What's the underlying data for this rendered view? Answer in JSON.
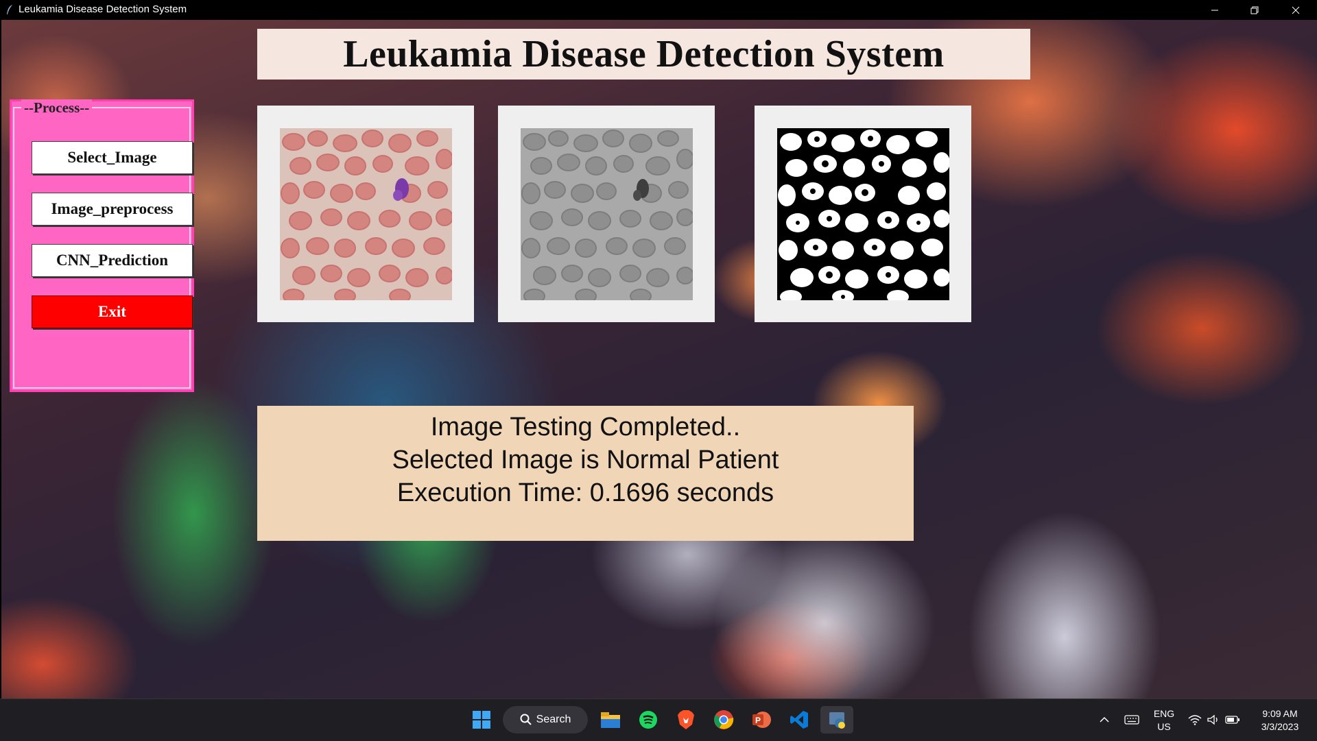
{
  "window": {
    "title": "Leukamia Disease Detection System",
    "controls": [
      "minimize",
      "maximize",
      "close"
    ]
  },
  "header": {
    "title": "Leukamia Disease Detection System"
  },
  "process_panel": {
    "legend": "--Process--",
    "buttons": {
      "select": "Select_Image",
      "preprocess": "Image_preprocess",
      "predict": "CNN_Prediction",
      "exit": "Exit"
    }
  },
  "images": [
    {
      "name": "original-blood-smear",
      "style": "color"
    },
    {
      "name": "grayscale-blood-smear",
      "style": "grayscale"
    },
    {
      "name": "binary-segmented-smear",
      "style": "binary"
    }
  ],
  "result": {
    "line1": "Image Testing Completed..",
    "line2": "Selected Image is Normal Patient",
    "line3": "Execution Time: 0.1696 seconds"
  },
  "taskbar": {
    "search_label": "Search",
    "apps": [
      "start-icon",
      "file-explorer-icon",
      "spotify-icon",
      "brave-icon",
      "chrome-icon",
      "powerpoint-icon",
      "vscode-icon",
      "python-icon"
    ],
    "language_line1": "ENG",
    "language_line2": "US",
    "time": "9:09 AM",
    "date": "3/3/2023"
  },
  "colors": {
    "process_bg": "#ff66c4",
    "exit_bg": "#ff0000",
    "header_bg": "#f5e6df",
    "result_bg": "#f0d5b6"
  }
}
